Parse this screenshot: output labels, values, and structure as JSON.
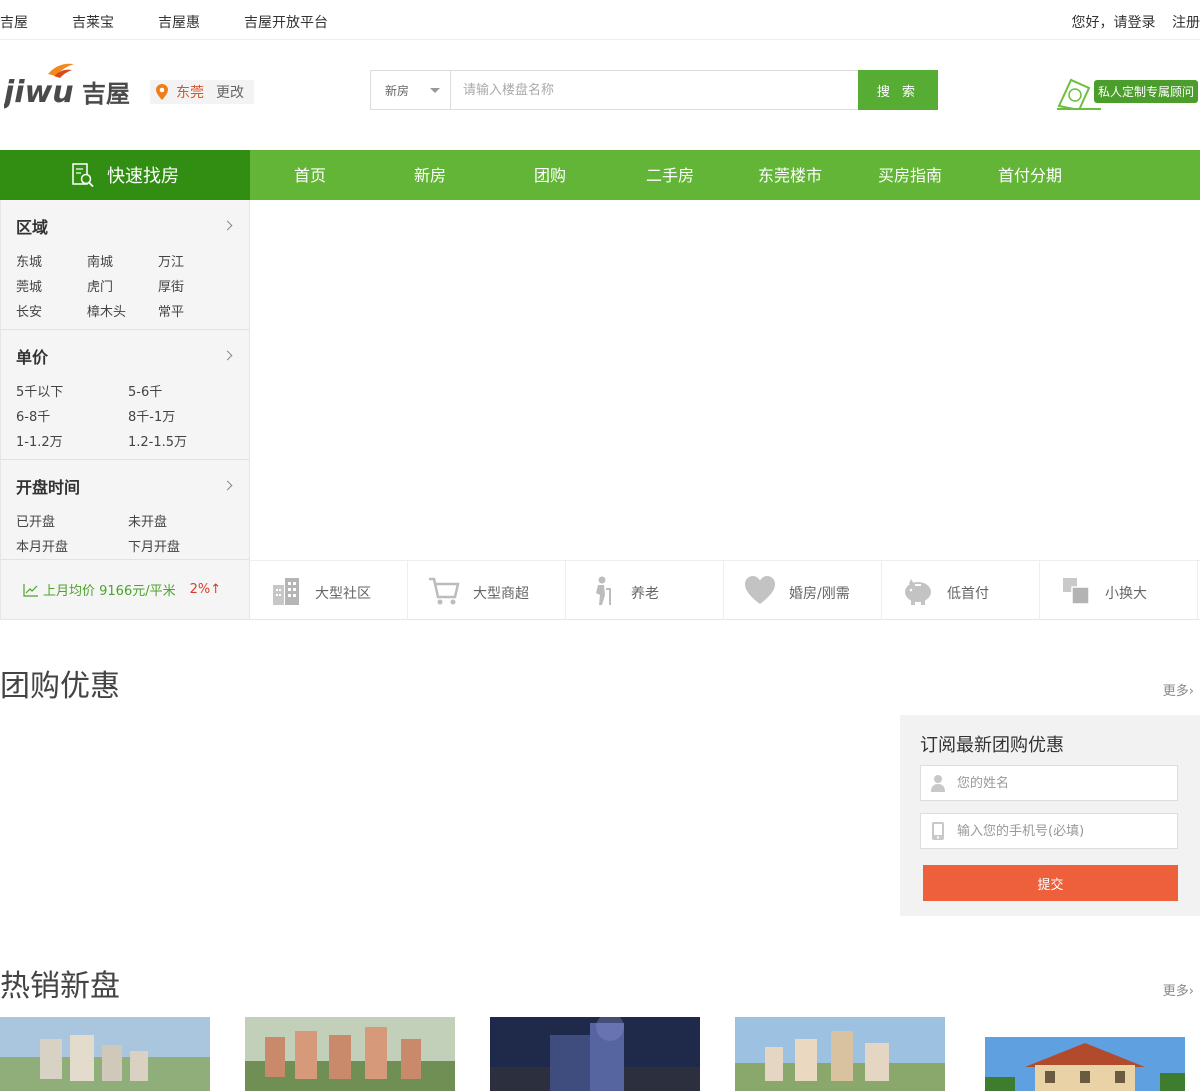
{
  "topbar": {
    "links": [
      "吉屋",
      "吉莱宝",
      "吉屋惠",
      "吉屋开放平台"
    ],
    "login": "您好，请登录",
    "register": "注册"
  },
  "header": {
    "logo_text": "jiwu吉屋",
    "city": "东莞",
    "change_city": "更改",
    "search_type": "新房",
    "search_placeholder": "请输入楼盘名称",
    "search_button": "搜 索",
    "consult_label": "私人定制专属顾问"
  },
  "nav": {
    "quick_find": "快速找房",
    "items": [
      "首页",
      "新房",
      "团购",
      "二手房",
      "东莞楼市",
      "买房指南",
      "首付分期"
    ]
  },
  "sidebar": {
    "area": {
      "title": "区域",
      "options": [
        "东城",
        "南城",
        "万江",
        "莞城",
        "虎门",
        "厚街",
        "长安",
        "樟木头",
        "常平"
      ]
    },
    "price": {
      "title": "单价",
      "options": [
        "5千以下",
        "5-6千",
        "6-8千",
        "8千-1万",
        "1-1.2万",
        "1.2-1.5万"
      ]
    },
    "opening": {
      "title": "开盘时间",
      "options": [
        "已开盘",
        "未开盘",
        "本月开盘",
        "下月开盘"
      ]
    },
    "trend": {
      "label": "上月均价 9166元/平米",
      "change": "2%↑"
    }
  },
  "tags": [
    {
      "label": "大型社区",
      "icon": "building-icon"
    },
    {
      "label": "大型商超",
      "icon": "cart-icon"
    },
    {
      "label": "养老",
      "icon": "elderly-icon"
    },
    {
      "label": "婚房/刚需",
      "icon": "heart-icon"
    },
    {
      "label": "低首付",
      "icon": "piggy-bank-icon"
    },
    {
      "label": "小换大",
      "icon": "upgrade-icon"
    }
  ],
  "groupbuy": {
    "title": "团购优惠",
    "more": "更多",
    "subscribe": {
      "title": "订阅最新团购优惠",
      "name_placeholder": "您的姓名",
      "phone_placeholder": "输入您的手机号(必填)",
      "submit": "提交"
    }
  },
  "hot": {
    "title": "热销新盘",
    "more": "更多"
  },
  "colors": {
    "nav_green": "#62b536",
    "quick_green": "#318e13",
    "accent_orange": "#ee5f3c"
  }
}
